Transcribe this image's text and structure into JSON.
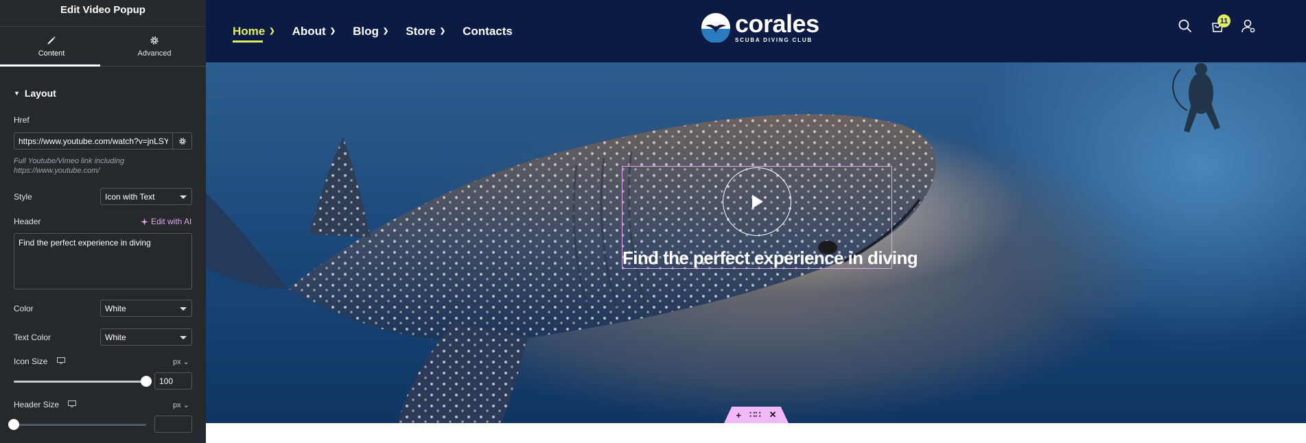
{
  "editor": {
    "title": "Edit Video Popup",
    "tabs": [
      {
        "label": "Content",
        "icon": "pencil-icon",
        "active": true
      },
      {
        "label": "Advanced",
        "icon": "gear-icon",
        "active": false
      }
    ],
    "section": "Layout",
    "href": {
      "label": "Href",
      "value": "https://www.youtube.com/watch?v=jnLSYf",
      "help": "Full Youtube/Vimeo link including https://www.youtube.com/"
    },
    "style": {
      "label": "Style",
      "value": "Icon with Text"
    },
    "header": {
      "label": "Header",
      "ai_label": "Edit with AI",
      "value": "Find the perfect experience in diving"
    },
    "color": {
      "label": "Color",
      "value": "White"
    },
    "text_color": {
      "label": "Text Color",
      "value": "White"
    },
    "icon_size": {
      "label": "Icon Size",
      "unit": "px",
      "value": "100",
      "fraction": 1.0
    },
    "header_size": {
      "label": "Header Size",
      "unit": "px",
      "value": "",
      "fraction": 0.0
    }
  },
  "site": {
    "nav": [
      {
        "label": "Home",
        "active": true,
        "has_submenu": true
      },
      {
        "label": "About",
        "active": false,
        "has_submenu": true
      },
      {
        "label": "Blog",
        "active": false,
        "has_submenu": true
      },
      {
        "label": "Store",
        "active": false,
        "has_submenu": true
      },
      {
        "label": "Contacts",
        "active": false,
        "has_submenu": false
      }
    ],
    "logo": {
      "name": "corales",
      "tagline": "SCUBA DIVING CLUB"
    },
    "cart_count": "11",
    "video": {
      "caption": "Find the perfect experience in diving"
    },
    "colors": {
      "header_bg": "#0c1b43",
      "accent": "#e3ef63",
      "selection": "#e3a6f5"
    }
  }
}
